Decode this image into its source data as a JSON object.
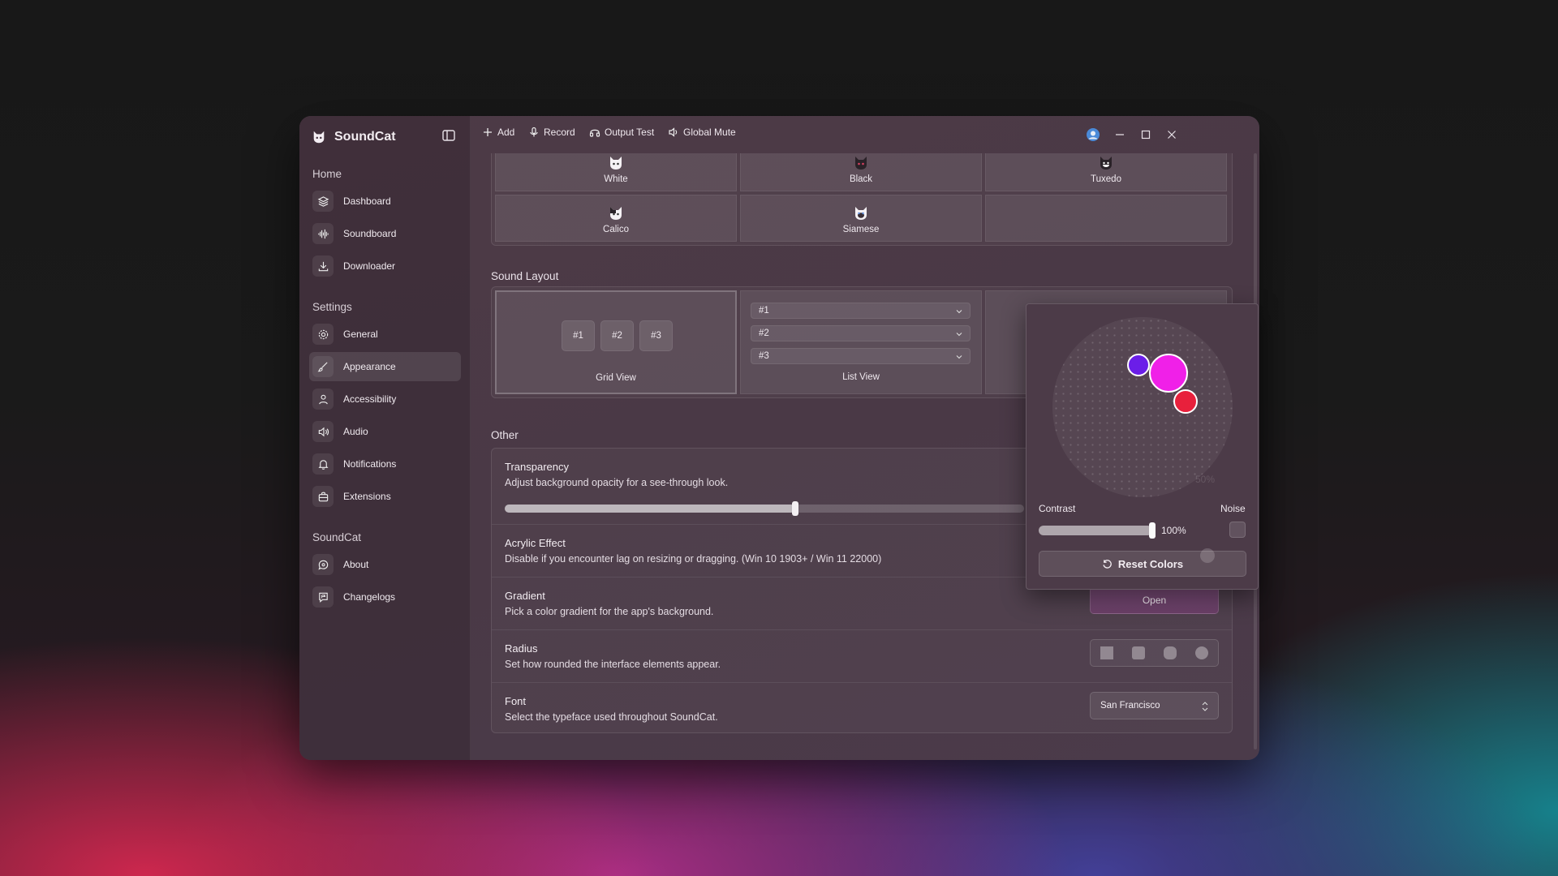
{
  "app": {
    "name": "SoundCat"
  },
  "toolbar": {
    "add": "Add",
    "record": "Record",
    "output_test": "Output Test",
    "global_mute": "Global Mute"
  },
  "sidebar": {
    "groups": [
      {
        "title": "Home",
        "items": [
          "Dashboard",
          "Soundboard",
          "Downloader"
        ]
      },
      {
        "title": "Settings",
        "items": [
          "General",
          "Appearance",
          "Accessibility",
          "Audio",
          "Notifications",
          "Extensions"
        ]
      },
      {
        "title": "SoundCat",
        "items": [
          "About",
          "Changelogs"
        ]
      }
    ],
    "active_item": "Appearance"
  },
  "icons": {
    "dashboard": "layers-icon",
    "soundboard": "waveform-icon",
    "downloader": "download-icon",
    "general": "gear-icon",
    "appearance": "brush-icon",
    "accessibility": "person-icon",
    "audio": "speaker-icon",
    "notifications": "bell-icon",
    "extensions": "puzzle-icon",
    "about": "info-chat-icon",
    "changelogs": "flag-chat-icon"
  },
  "themes": {
    "tiles": [
      "White",
      "Black",
      "Tuxedo",
      "Calico",
      "Siamese"
    ]
  },
  "sound_layout": {
    "title": "Sound Layout",
    "grid": {
      "chips": [
        "#1",
        "#2",
        "#3"
      ],
      "label": "Grid View"
    },
    "list": {
      "rows": [
        "#1",
        "#2",
        "#3"
      ],
      "label": "List View"
    }
  },
  "other": {
    "title": "Other",
    "transparency": {
      "title": "Transparency",
      "desc": "Adjust background opacity for a see-through look.",
      "value_fraction": 0.56
    },
    "acrylic": {
      "title": "Acrylic Effect",
      "desc": "Disable if you encounter lag on resizing or dragging. (Win 10 1903+ / Win 11 22000)"
    },
    "gradient": {
      "title": "Gradient",
      "desc": "Pick a color gradient for the app's background.",
      "button": "Open"
    },
    "radius": {
      "title": "Radius",
      "desc": "Set how rounded the interface elements appear.",
      "selected_index": 1
    },
    "font": {
      "title": "Font",
      "desc": "Select the typeface used throughout SoundCat.",
      "value": "San Francisco"
    }
  },
  "gradient_popover": {
    "wheel_label": "50%",
    "contrast_label": "Contrast",
    "contrast_value": "100%",
    "contrast_fraction": 1.0,
    "noise_label": "Noise",
    "reset_button": "Reset Colors",
    "colors": [
      "#6b1ee8",
      "#f020e8",
      "#e8203c"
    ]
  },
  "colors": {
    "accent": "#7a4c78"
  }
}
